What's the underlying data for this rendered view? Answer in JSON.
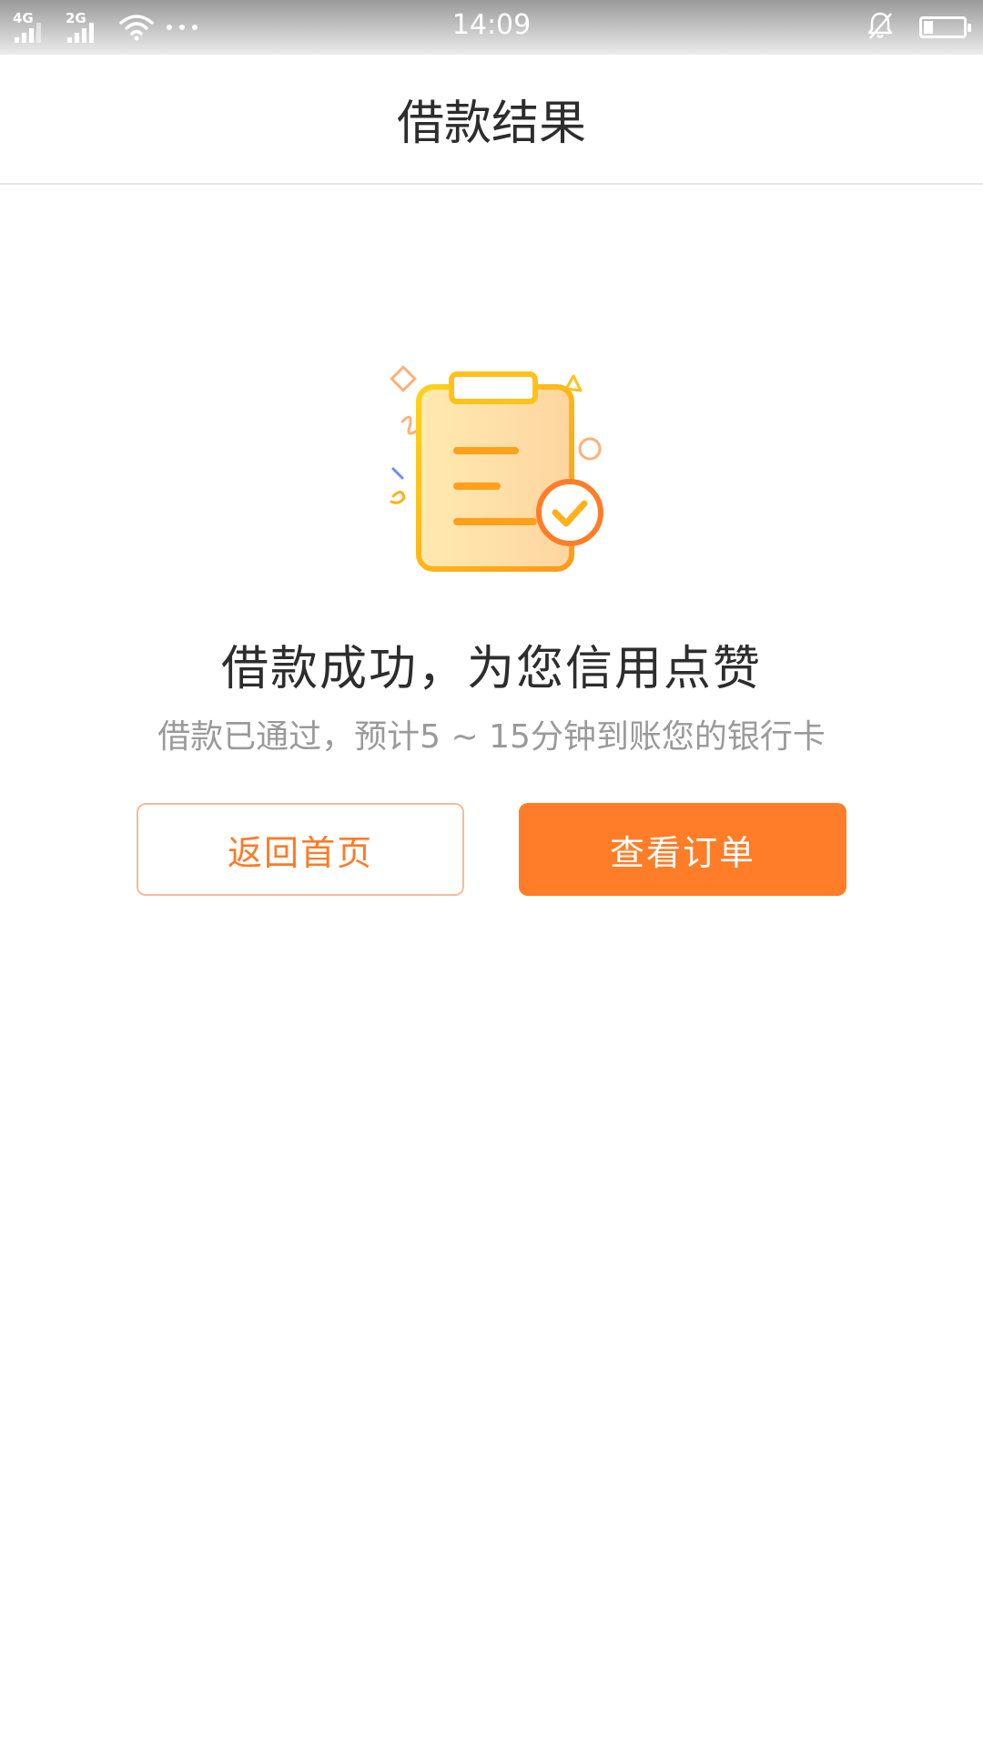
{
  "status_bar": {
    "network_1": "4G",
    "network_2": "2G",
    "time": "14:09",
    "icons": [
      "signal-icon",
      "wifi-icon",
      "more-dots-icon",
      "bell-off-icon",
      "battery-icon"
    ]
  },
  "header": {
    "title": "借款结果"
  },
  "result": {
    "title": "借款成功，为您信用点赞",
    "subtitle": "借款已通过，预计5 ~ 15分钟到账您的银行卡",
    "icon": "clipboard-check-icon"
  },
  "actions": {
    "home_label": "返回首页",
    "order_label": "查看订单"
  },
  "colors": {
    "accent": "#ff7d28",
    "outline_border": "#f5bc99",
    "title_text": "#2d2d2d",
    "sub_text": "#9a9a9a"
  }
}
